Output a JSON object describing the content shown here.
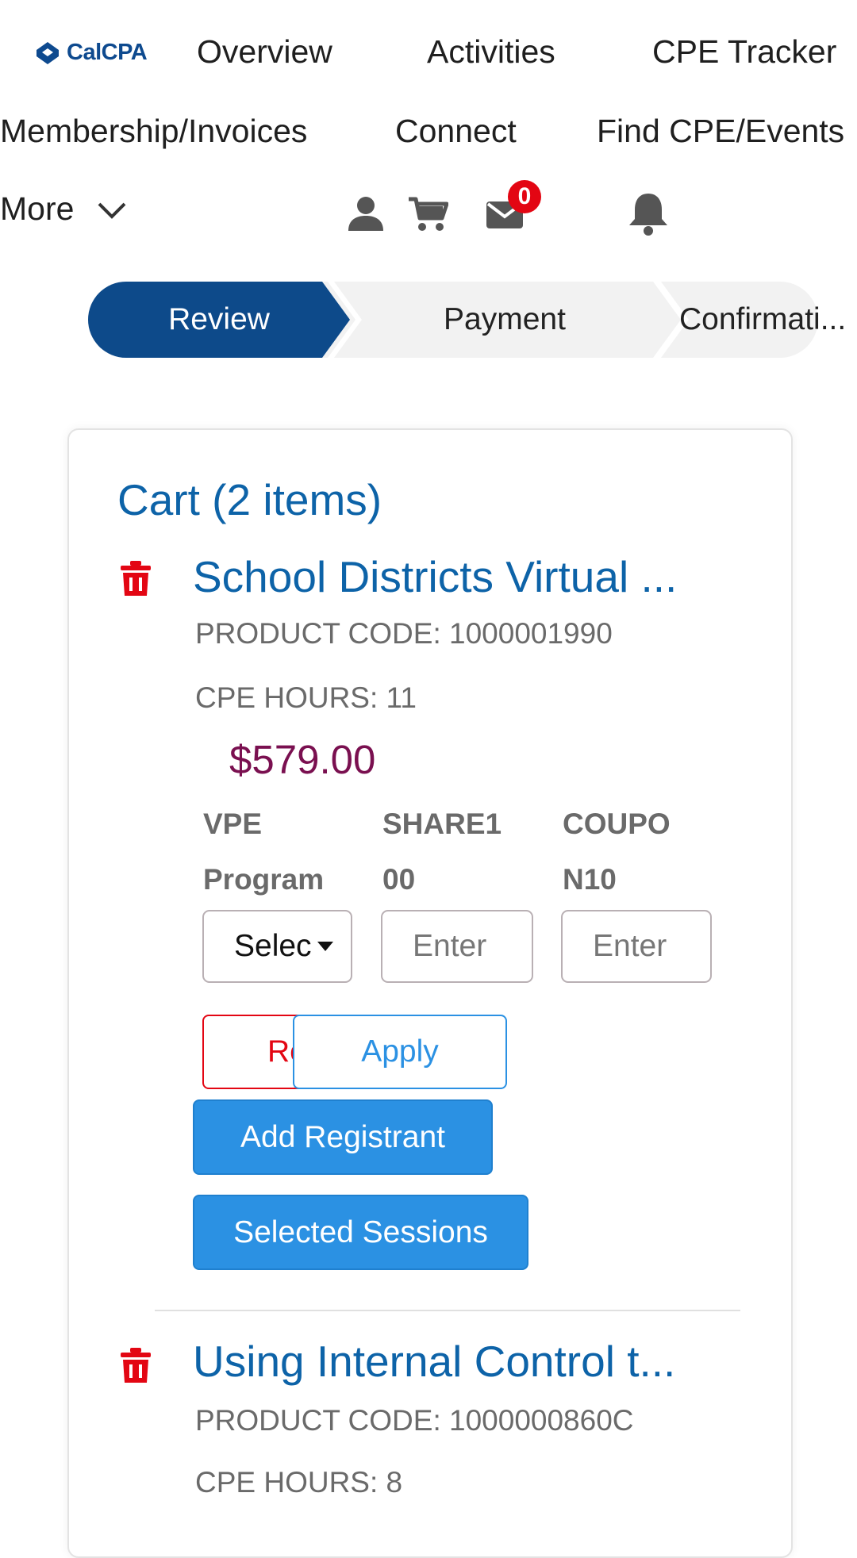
{
  "header": {
    "logo_text": "CalCPA",
    "nav": {
      "overview": "Overview",
      "activities": "Activities",
      "cpe_tracker": "CPE Tracker",
      "membership": "Membership/Invoices",
      "connect": "Connect",
      "find_cpe": "Find CPE/Events",
      "more": "More"
    },
    "icons": [
      "person-icon",
      "cart-icon",
      "mail-icon",
      "bell-icon"
    ],
    "mail_badge": "0"
  },
  "stepper": {
    "steps": [
      "Review",
      "Payment",
      "Confirmati..."
    ],
    "active_index": 0,
    "active_color": "#0d4a8a",
    "inactive_color": "#f2f2f2"
  },
  "cart": {
    "title": "Cart (2 items)",
    "items": [
      {
        "title": "School Districts Virtual ...",
        "product_code": "PRODUCT CODE: 1000001990",
        "cpe_hours": "CPE HOURS: 11",
        "price": "$579.00",
        "fields": [
          {
            "label_line1": "VPE",
            "label_line2": "Program",
            "value": "Selec"
          },
          {
            "label_line1": "SHARE1",
            "label_line2": "00",
            "placeholder": "Enter"
          },
          {
            "label_line1": "COUPO",
            "label_line2": "N10",
            "placeholder": "Enter"
          }
        ],
        "remove_label_partial": "Re",
        "apply_label": "Apply",
        "add_registrant_label": "Add Registrant",
        "selected_sessions_label": "Selected Sessions"
      },
      {
        "title": "Using Internal Control t...",
        "product_code": "PRODUCT CODE: 1000000860C",
        "cpe_hours": "CPE HOURS: 8"
      }
    ]
  },
  "colors": {
    "brand": "#0e4a8f",
    "link_blue": "#0d63a8",
    "button_blue": "#2b91e3",
    "danger_red": "#e30613",
    "price": "#7a1050"
  }
}
